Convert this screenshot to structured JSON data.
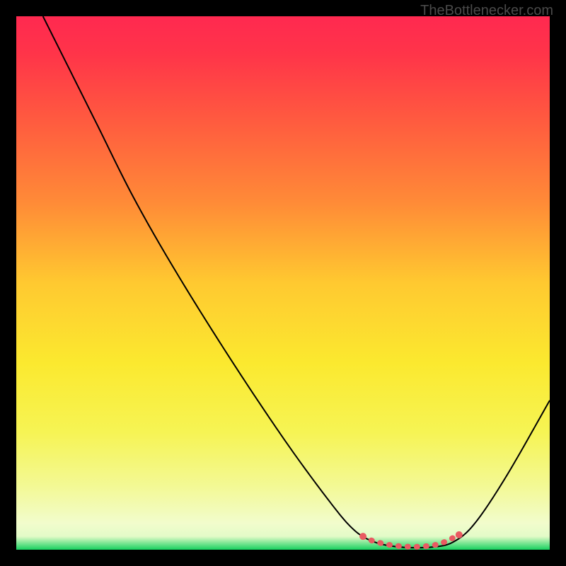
{
  "watermark": "TheBottlenecker.com",
  "chart_data": {
    "type": "line",
    "title": "",
    "xlabel": "",
    "ylabel": "",
    "xlim": [
      0,
      100
    ],
    "ylim": [
      0,
      100
    ],
    "gradient_stops": [
      {
        "offset": 0.0,
        "color": "#ff2950"
      },
      {
        "offset": 0.07,
        "color": "#ff3449"
      },
      {
        "offset": 0.2,
        "color": "#ff5c3f"
      },
      {
        "offset": 0.35,
        "color": "#ff8b37"
      },
      {
        "offset": 0.5,
        "color": "#ffc930"
      },
      {
        "offset": 0.65,
        "color": "#fbe92f"
      },
      {
        "offset": 0.78,
        "color": "#f6f454"
      },
      {
        "offset": 0.88,
        "color": "#f3f994"
      },
      {
        "offset": 0.95,
        "color": "#f2fccc"
      },
      {
        "offset": 0.975,
        "color": "#e3fbc8"
      },
      {
        "offset": 1.0,
        "color": "#17d160"
      }
    ],
    "series": [
      {
        "name": "bottleneck-curve",
        "points": [
          {
            "x": 5.0,
            "y": 100.0
          },
          {
            "x": 9.0,
            "y": 92.0
          },
          {
            "x": 15.0,
            "y": 80.0
          },
          {
            "x": 22.0,
            "y": 66.0
          },
          {
            "x": 30.0,
            "y": 52.0
          },
          {
            "x": 40.0,
            "y": 36.0
          },
          {
            "x": 50.0,
            "y": 21.0
          },
          {
            "x": 58.0,
            "y": 10.0
          },
          {
            "x": 63.0,
            "y": 4.0
          },
          {
            "x": 67.0,
            "y": 1.5
          },
          {
            "x": 72.0,
            "y": 0.5
          },
          {
            "x": 78.0,
            "y": 0.5
          },
          {
            "x": 82.0,
            "y": 1.5
          },
          {
            "x": 86.0,
            "y": 5.0
          },
          {
            "x": 92.0,
            "y": 14.0
          },
          {
            "x": 100.0,
            "y": 28.0
          }
        ]
      },
      {
        "name": "optimal-highlight",
        "color": "#e95a62",
        "points": [
          {
            "x": 65.0,
            "y": 2.5
          },
          {
            "x": 67.0,
            "y": 1.6
          },
          {
            "x": 70.0,
            "y": 0.9
          },
          {
            "x": 73.0,
            "y": 0.6
          },
          {
            "x": 76.0,
            "y": 0.6
          },
          {
            "x": 79.0,
            "y": 1.0
          },
          {
            "x": 81.0,
            "y": 1.8
          },
          {
            "x": 83.0,
            "y": 2.8
          }
        ]
      }
    ]
  }
}
